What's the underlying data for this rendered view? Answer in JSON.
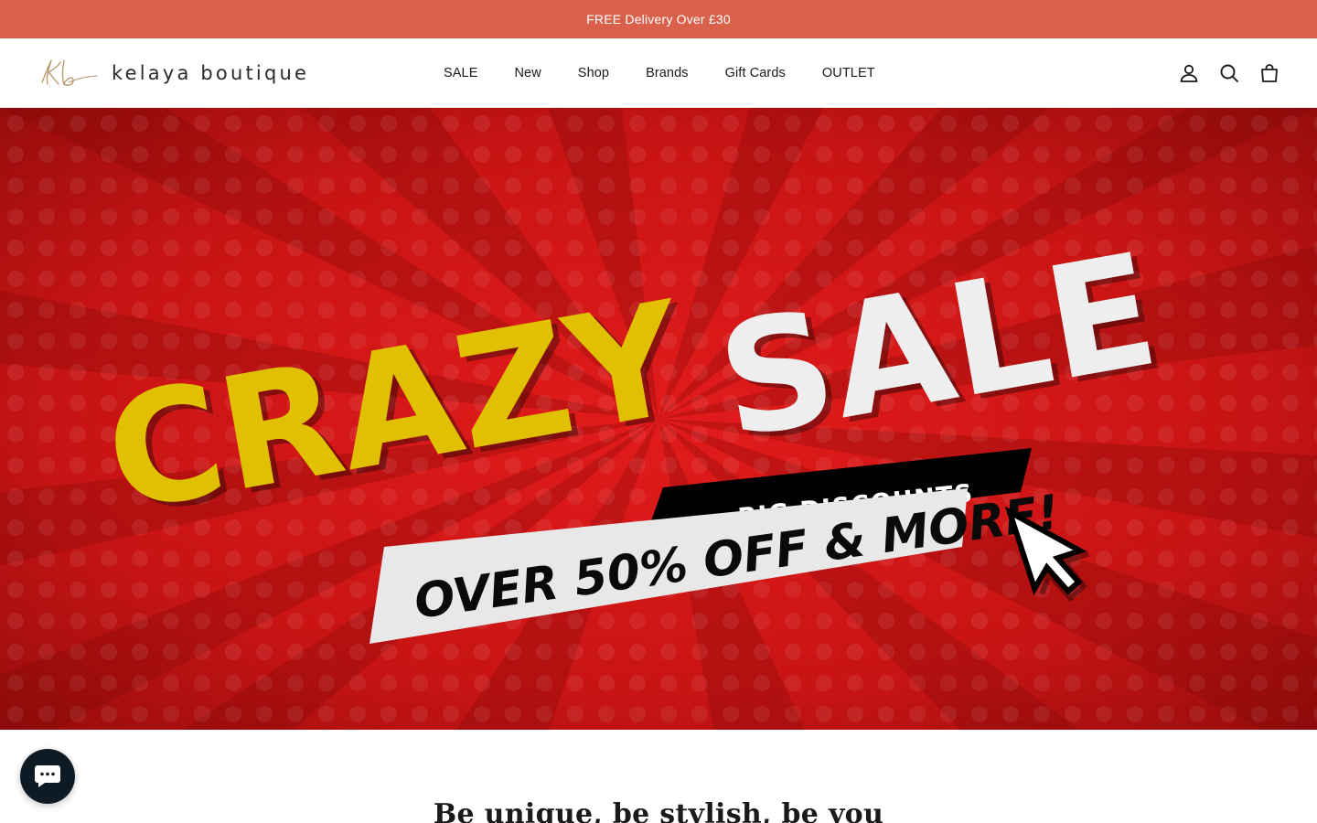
{
  "announcement": {
    "text": "FREE Delivery Over £30"
  },
  "header": {
    "logo": {
      "monogram": "Kb",
      "name": "kelaya boutique"
    },
    "nav": [
      {
        "label": "SALE"
      },
      {
        "label": "New"
      },
      {
        "label": "Shop"
      },
      {
        "label": "Brands"
      },
      {
        "label": "Gift Cards"
      },
      {
        "label": "OUTLET"
      }
    ],
    "icons": [
      "account-icon",
      "search-icon",
      "cart-icon"
    ]
  },
  "hero": {
    "headline_word_1": "CRAZY",
    "headline_word_2": "SALE",
    "badge_text": "BIG DISCOUNTS",
    "offer_text": "OVER 50% OFF & MORE!",
    "colors": {
      "background": "#cc1515",
      "headline_1": "#e0c000",
      "headline_2": "#eeeeee",
      "badge": "#000000",
      "offer_strip": "#e8e8e8"
    }
  },
  "tagline": {
    "text": "Be unique, be stylish, be you"
  },
  "chat": {
    "icon": "chat-icon"
  },
  "colors": {
    "announcement_bg": "#d9604a",
    "chat_bg": "#0f1b24"
  }
}
